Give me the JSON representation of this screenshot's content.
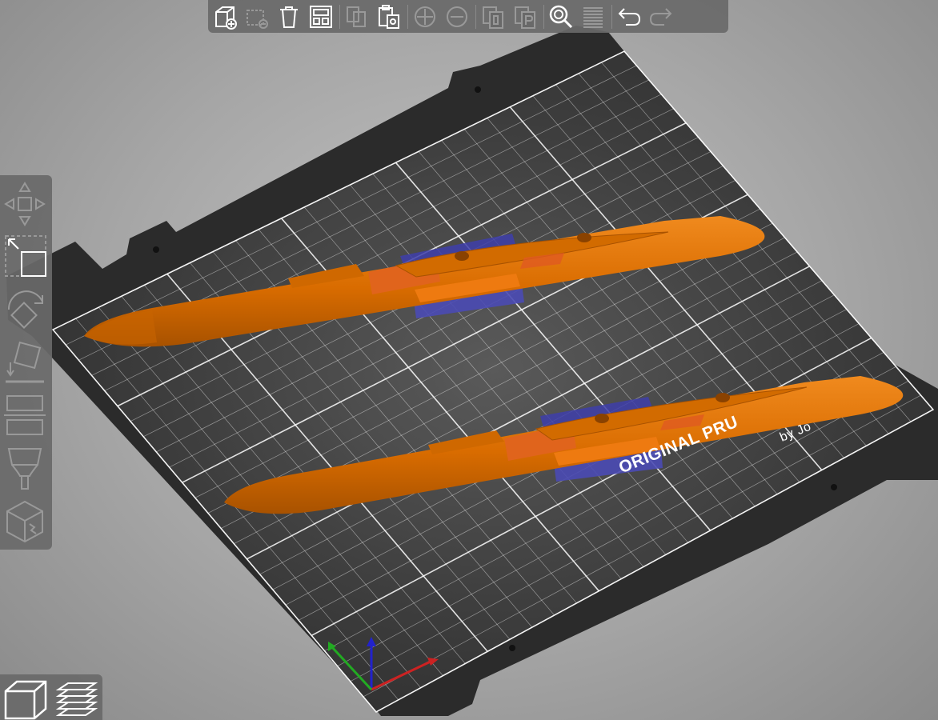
{
  "window": {
    "type": "3D slicer plater view"
  },
  "bed": {
    "logo_text": "ORIGINAL PRU",
    "byline_text": "by Jo"
  },
  "toolbar_top": {
    "buttons": [
      {
        "name": "add",
        "icon": "add-object-icon",
        "enabled": true
      },
      {
        "name": "delete",
        "icon": "delete-icon",
        "enabled": false
      },
      {
        "name": "delete_all",
        "icon": "delete-all-icon",
        "enabled": true
      },
      {
        "name": "arrange",
        "icon": "arrange-icon",
        "enabled": true
      },
      {
        "name": "copy",
        "icon": "copy-icon",
        "enabled": false
      },
      {
        "name": "paste",
        "icon": "paste-icon",
        "enabled": true
      },
      {
        "name": "add_instance",
        "icon": "add-instance-icon",
        "enabled": false
      },
      {
        "name": "remove_instance",
        "icon": "remove-instance-icon",
        "enabled": false
      },
      {
        "name": "split_objects",
        "icon": "split-objects-icon",
        "enabled": false
      },
      {
        "name": "split_parts",
        "icon": "split-parts-icon",
        "enabled": false
      },
      {
        "name": "search",
        "icon": "search-icon",
        "enabled": true
      },
      {
        "name": "layers",
        "icon": "layers-editing-icon",
        "enabled": false
      },
      {
        "name": "undo",
        "icon": "undo-icon",
        "enabled": true
      },
      {
        "name": "redo",
        "icon": "redo-icon",
        "enabled": false
      }
    ]
  },
  "toolbar_left": {
    "tools": [
      {
        "name": "move",
        "icon": "move-icon"
      },
      {
        "name": "scale",
        "icon": "scale-icon"
      },
      {
        "name": "rotate",
        "icon": "rotate-icon"
      },
      {
        "name": "place_on_face",
        "icon": "place-on-face-icon"
      },
      {
        "name": "cut",
        "icon": "cut-icon"
      },
      {
        "name": "paint_supports",
        "icon": "paint-supports-icon"
      },
      {
        "name": "seam",
        "icon": "seam-painting-icon"
      }
    ]
  },
  "view_switch": {
    "options": [
      {
        "name": "3d_view",
        "icon": "3d-view-icon",
        "active": true
      },
      {
        "name": "preview",
        "icon": "layers-preview-icon",
        "active": false
      }
    ]
  },
  "colors": {
    "model": "#e07000",
    "model_dark": "#b85a00",
    "support_blocker": "#4a4aa8",
    "bed_surface": "#3a3a3a",
    "grid": "#ffffff",
    "axis_x": "#cc2222",
    "axis_y": "#22aa22",
    "axis_z": "#2222cc",
    "toolbar_bg": "#696969"
  }
}
